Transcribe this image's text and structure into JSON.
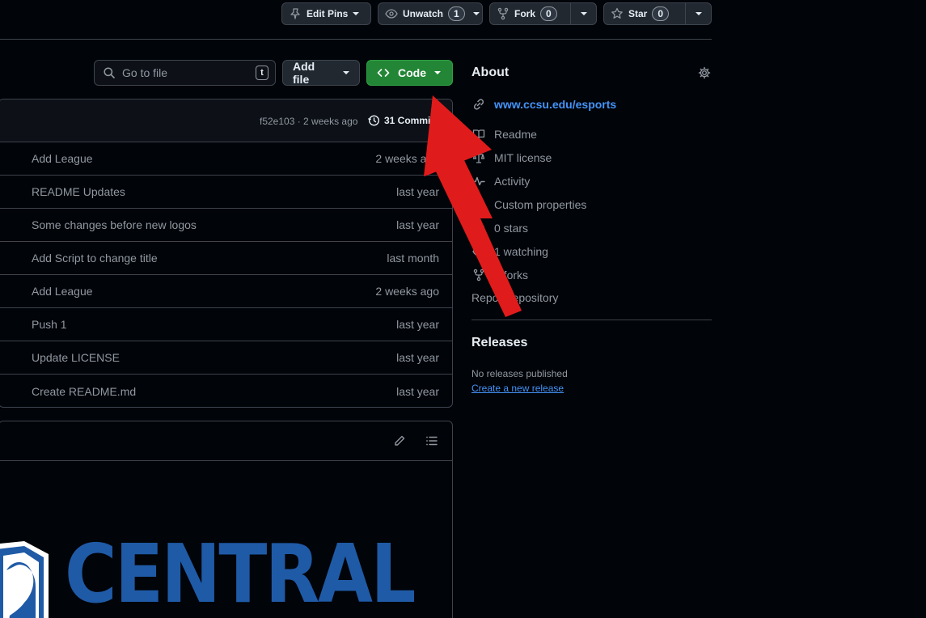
{
  "toolbar": {
    "edit_pins_label": "Edit Pins",
    "unwatch_label": "Unwatch",
    "unwatch_count": "1",
    "fork_label": "Fork",
    "fork_count": "0",
    "star_label": "Star",
    "star_count": "0"
  },
  "file_controls": {
    "search_placeholder": "Go to file",
    "search_shortcut": "t",
    "add_file_label": "Add file",
    "code_label": "Code"
  },
  "latest_commit": {
    "hash_time": "f52e103 · 2 weeks ago",
    "commits_label": "31 Commits"
  },
  "files": [
    {
      "message": "Add League",
      "when": "2 weeks ago"
    },
    {
      "message": "README Updates",
      "when": "last year"
    },
    {
      "message": "Some changes before new logos",
      "when": "last year"
    },
    {
      "message": "Add Script to change title",
      "when": "last month"
    },
    {
      "message": "Add League",
      "when": "2 weeks ago"
    },
    {
      "message": "Push 1",
      "when": "last year"
    },
    {
      "message": "Update LICENSE",
      "when": "last year"
    },
    {
      "message": "Create README.md",
      "when": "last year"
    }
  ],
  "readme_banner": {
    "text": "CENTRAL"
  },
  "about": {
    "title": "About",
    "website": "www.ccsu.edu/esports",
    "readme": "Readme",
    "license": "MIT license",
    "activity": "Activity",
    "custom_properties": "Custom properties",
    "stars": "0 stars",
    "watching": "1 watching",
    "forks": "0 forks",
    "report": "Report repository"
  },
  "releases": {
    "title": "Releases",
    "none_text": "No releases published",
    "create_link": "Create a new release"
  },
  "colors": {
    "background": "#010409",
    "accent_link": "#4493f8",
    "code_button": "#238636",
    "annotation_arrow": "#e01b1b",
    "banner_blue": "#1f5aa6"
  }
}
